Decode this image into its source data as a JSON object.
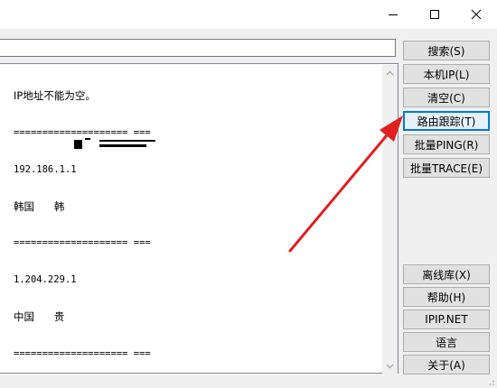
{
  "window": {
    "controls": [
      {
        "name": "minimize-button",
        "icon": "minimize-icon"
      },
      {
        "name": "maximize-button",
        "icon": "maximize-icon"
      },
      {
        "name": "close-button",
        "icon": "close-icon"
      }
    ]
  },
  "search": {
    "value": "",
    "placeholder": ""
  },
  "output": {
    "lines": [
      "IP地址不能为空。",
      "==================== ===",
      "192.186.1.1",
      "韩国      韩",
      "==================== ===",
      "1.204.229.1",
      "中国      贵",
      "==================== ==="
    ]
  },
  "buttons": {
    "search": "搜索(S)",
    "local_ip": "本机IP(L)",
    "clear": "清空(C)",
    "traceroute": "路由跟踪(T)",
    "batch_ping": "批量PING(R)",
    "batch_trace": "批量TRACE(E)",
    "offline_db": "离线库(X)",
    "help": "帮助(H)",
    "ipip": "IPIP.NET",
    "language": "语言",
    "about": "关于(A)"
  },
  "colors": {
    "annotation_arrow": "#e02020",
    "focus_border": "#0078d7"
  }
}
